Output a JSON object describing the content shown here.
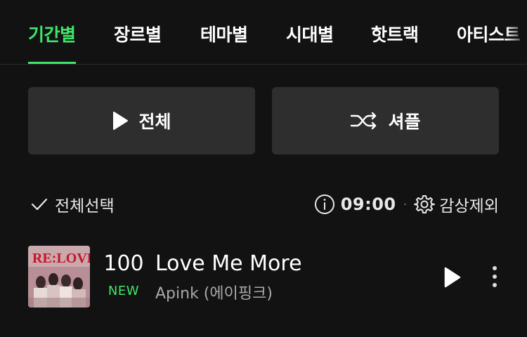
{
  "tabs": [
    {
      "label": "기간별",
      "active": true
    },
    {
      "label": "장르별",
      "active": false
    },
    {
      "label": "테마별",
      "active": false
    },
    {
      "label": "시대별",
      "active": false
    },
    {
      "label": "핫트랙",
      "active": false
    },
    {
      "label": "아티스트",
      "active": false
    }
  ],
  "actions": {
    "play_all_label": "전체",
    "shuffle_label": "셔플"
  },
  "controls": {
    "select_all_label": "전체선택",
    "time": "09:00",
    "separator": "·",
    "exclude_label": "감상제외"
  },
  "songs": [
    {
      "rank": "100",
      "badge": "NEW",
      "title": "Love Me More",
      "artist": "Apink (에이핑크)",
      "album_art_text": "RE:LOVE"
    }
  ],
  "colors": {
    "background": "#121212",
    "accent": "#3ee66a",
    "button_bg": "#2e2e2e",
    "secondary_text": "#a9a9a9"
  },
  "icons": {
    "play": "play-icon",
    "shuffle": "shuffle-icon",
    "check": "check-icon",
    "info": "info-icon",
    "settings": "gear-icon",
    "more": "more-vertical-icon"
  }
}
